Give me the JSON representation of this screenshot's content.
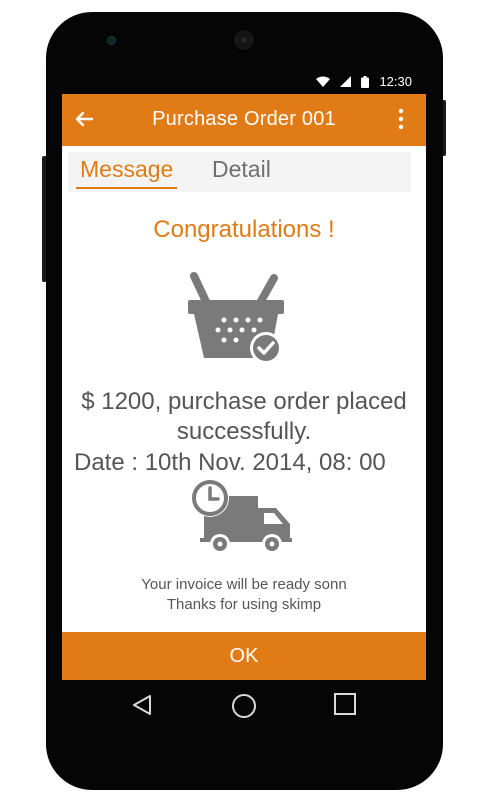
{
  "status_bar": {
    "time": "12:30"
  },
  "app_bar": {
    "title": "Purchase Order 001"
  },
  "tabs": [
    {
      "label": "Message",
      "selected": true
    },
    {
      "label": "Detail",
      "selected": false
    }
  ],
  "message": {
    "heading": "Congratulations !",
    "line1": "$ 1200, purchase order placed",
    "line2": "successfully.",
    "date": "Date : 10th Nov. 2014, 08: 00",
    "invoice_note": "Your invoice will be ready sonn",
    "thanks_note": "Thanks for using skimp"
  },
  "actions": {
    "ok_label": "OK"
  },
  "icons": {
    "back": "arrow-left-icon",
    "more": "more-vertical-icon",
    "basket": "basket-check-icon",
    "delivery": "clock-truck-icon",
    "wifi": "wifi-icon",
    "signal": "signal-icon",
    "battery": "battery-icon",
    "nav_back": "triangle-back-icon",
    "nav_home": "circle-home-icon",
    "nav_recent": "square-recent-icon"
  },
  "colors": {
    "accent": "#e07b15",
    "text": "#555555",
    "tab_inactive": "#6f6f6f",
    "icon_gray": "#7a7a7a"
  }
}
